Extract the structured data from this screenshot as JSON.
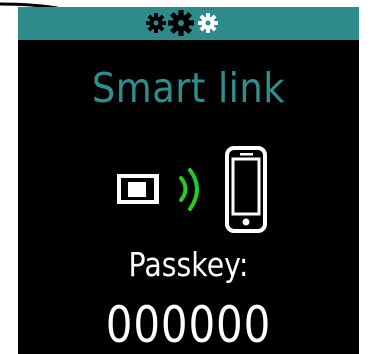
{
  "status_bar": {
    "color": "#2e8b8b",
    "icons": [
      "gear-icon",
      "gear-icon",
      "gear-icon"
    ]
  },
  "screen": {
    "title": "Smart link",
    "title_color": "#2e8f8f",
    "passkey_label": "Passkey:",
    "passkey_value": "000000"
  },
  "graphic": {
    "icons": [
      "device-icon",
      "signal-waves-icon",
      "phone-icon"
    ],
    "signal_color": "#22cc22"
  }
}
